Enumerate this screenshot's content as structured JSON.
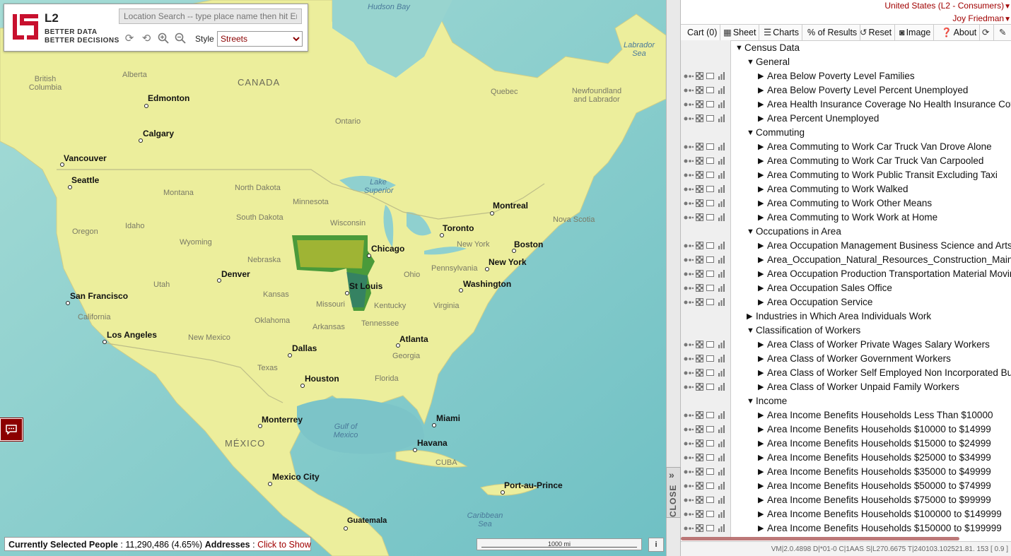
{
  "map": {
    "search_placeholder": "Location Search -- type place name then hit Enter",
    "style_label": "Style",
    "style_selected": "Streets",
    "logo": {
      "mark": "L2",
      "tag1": "BETTER DATA",
      "tag2": "BETTER DECISIONS"
    },
    "labels": {
      "countries": [
        {
          "text": "CANADA"
        },
        {
          "text": "MÉXICO"
        }
      ],
      "water": [
        {
          "text": "Hudson Bay"
        },
        {
          "text": "Labrador Sea"
        },
        {
          "text": "Lake Superior"
        },
        {
          "text": "Gulf of Mexico"
        },
        {
          "text": "Caribbean Sea"
        }
      ],
      "regions": [
        "British Columbia",
        "Alberta",
        "Ontario",
        "Quebec",
        "Newfoundland and Labrador",
        "Montana",
        "North Dakota",
        "Minnesota",
        "Oregon",
        "Idaho",
        "South Dakota",
        "Wisconsin",
        "Wyoming",
        "Nebraska",
        "Utah",
        "Kansas",
        "Missouri",
        "Oklahoma",
        "Arkansas",
        "California",
        "Texas",
        "New Mexico",
        "Tennessee",
        "Kentucky",
        "Virginia",
        "Ohio",
        "Pennsylvania",
        "New York",
        "Nova Scotia",
        "Georgia",
        "Florida",
        "CUBA"
      ],
      "cities": [
        "Edmonton",
        "Calgary",
        "Vancouver",
        "Seattle",
        "Montreal",
        "Toronto",
        "Boston",
        "Chicago",
        "New York",
        "Denver",
        "St Louis",
        "Washington",
        "San Francisco",
        "Los Angeles",
        "Dallas",
        "Atlanta",
        "Houston",
        "Monterrey",
        "Miami",
        "Havana",
        "Mexico City",
        "Port-au-Prince",
        "Guatemala"
      ]
    },
    "status": {
      "label": "Currently Selected People",
      "value": " : 11,290,486 (4.65%) ",
      "addresses_label": "Addresses",
      "sep": " : ",
      "click_to_show": "Click to Show"
    },
    "scale": "1000 mi",
    "info_button": "i",
    "close_tab": "CLOSE"
  },
  "account": {
    "region": "United States (L2 - Consumers)",
    "user": "Joy Friedman"
  },
  "toolbar": {
    "cart": "Cart (0)",
    "sheet": "Sheet",
    "charts": "Charts",
    "percent": "% of Results",
    "reset": "Reset",
    "image": "Image",
    "about": "About"
  },
  "tree": [
    {
      "level": 0,
      "open": true,
      "icons": false,
      "label": "Census Data"
    },
    {
      "level": 1,
      "open": true,
      "icons": false,
      "label": "General"
    },
    {
      "level": 2,
      "open": false,
      "icons": true,
      "label": "Area Below Poverty Level Families"
    },
    {
      "level": 2,
      "open": false,
      "icons": true,
      "label": "Area Below Poverty Level Percent Unemployed"
    },
    {
      "level": 2,
      "open": false,
      "icons": true,
      "label": "Area Health Insurance Coverage No Health Insurance Coverage"
    },
    {
      "level": 2,
      "open": false,
      "icons": true,
      "label": "Area Percent Unemployed"
    },
    {
      "level": 1,
      "open": true,
      "icons": false,
      "label": "Commuting"
    },
    {
      "level": 2,
      "open": false,
      "icons": true,
      "label": "Area Commuting to Work Car Truck Van Drove Alone"
    },
    {
      "level": 2,
      "open": false,
      "icons": true,
      "label": "Area Commuting to Work Car Truck Van Carpooled"
    },
    {
      "level": 2,
      "open": false,
      "icons": true,
      "label": "Area Commuting to Work Public Transit Excluding Taxi"
    },
    {
      "level": 2,
      "open": false,
      "icons": true,
      "label": "Area Commuting to Work Walked"
    },
    {
      "level": 2,
      "open": false,
      "icons": true,
      "label": "Area Commuting to Work Other Means"
    },
    {
      "level": 2,
      "open": false,
      "icons": true,
      "label": "Area Commuting to Work Work at Home"
    },
    {
      "level": 1,
      "open": true,
      "icons": false,
      "label": "Occupations in Area"
    },
    {
      "level": 2,
      "open": false,
      "icons": true,
      "label": "Area Occupation Management Business Science and Arts"
    },
    {
      "level": 2,
      "open": false,
      "icons": true,
      "label": "Area_Occupation_Natural_Resources_Construction_Maintenance"
    },
    {
      "level": 2,
      "open": false,
      "icons": true,
      "label": "Area Occupation Production Transportation Material Moving"
    },
    {
      "level": 2,
      "open": false,
      "icons": true,
      "label": "Area Occupation Sales Office"
    },
    {
      "level": 2,
      "open": false,
      "icons": true,
      "label": "Area Occupation Service"
    },
    {
      "level": 1,
      "open": false,
      "icons": false,
      "label": "Industries in Which Area Individuals Work"
    },
    {
      "level": 1,
      "open": true,
      "icons": false,
      "label": "Classification of Workers"
    },
    {
      "level": 2,
      "open": false,
      "icons": true,
      "label": "Area Class of Worker Private Wages Salary Workers"
    },
    {
      "level": 2,
      "open": false,
      "icons": true,
      "label": "Area Class of Worker Government Workers"
    },
    {
      "level": 2,
      "open": false,
      "icons": true,
      "label": "Area Class of Worker Self Employed Non Incorporated Business"
    },
    {
      "level": 2,
      "open": false,
      "icons": true,
      "label": "Area Class of Worker Unpaid Family Workers"
    },
    {
      "level": 1,
      "open": true,
      "icons": false,
      "label": "Income"
    },
    {
      "level": 2,
      "open": false,
      "icons": true,
      "label": "Area Income Benefits Households Less Than $10000"
    },
    {
      "level": 2,
      "open": false,
      "icons": true,
      "label": "Area Income Benefits Households $10000 to $14999"
    },
    {
      "level": 2,
      "open": false,
      "icons": true,
      "label": "Area Income Benefits Households $15000 to $24999"
    },
    {
      "level": 2,
      "open": false,
      "icons": true,
      "label": "Area Income Benefits Households $25000 to $34999"
    },
    {
      "level": 2,
      "open": false,
      "icons": true,
      "label": "Area Income Benefits Households $35000 to $49999"
    },
    {
      "level": 2,
      "open": false,
      "icons": true,
      "label": "Area Income Benefits Households $50000 to $74999"
    },
    {
      "level": 2,
      "open": false,
      "icons": true,
      "label": "Area Income Benefits Households $75000 to $99999"
    },
    {
      "level": 2,
      "open": false,
      "icons": true,
      "label": "Area Income Benefits Households $100000 to $149999"
    },
    {
      "level": 2,
      "open": false,
      "icons": true,
      "label": "Area Income Benefits Households $150000 to $199999"
    }
  ],
  "footer": "VM|2.0.4898 D|*01-0 C|1AAS S|L270.6675 T|240103.102521.81. 153 [ 0.9 ]",
  "colors": {
    "brand_red": "#a00000",
    "land": "#eef0a0",
    "ocean": "#8fd3cf"
  }
}
